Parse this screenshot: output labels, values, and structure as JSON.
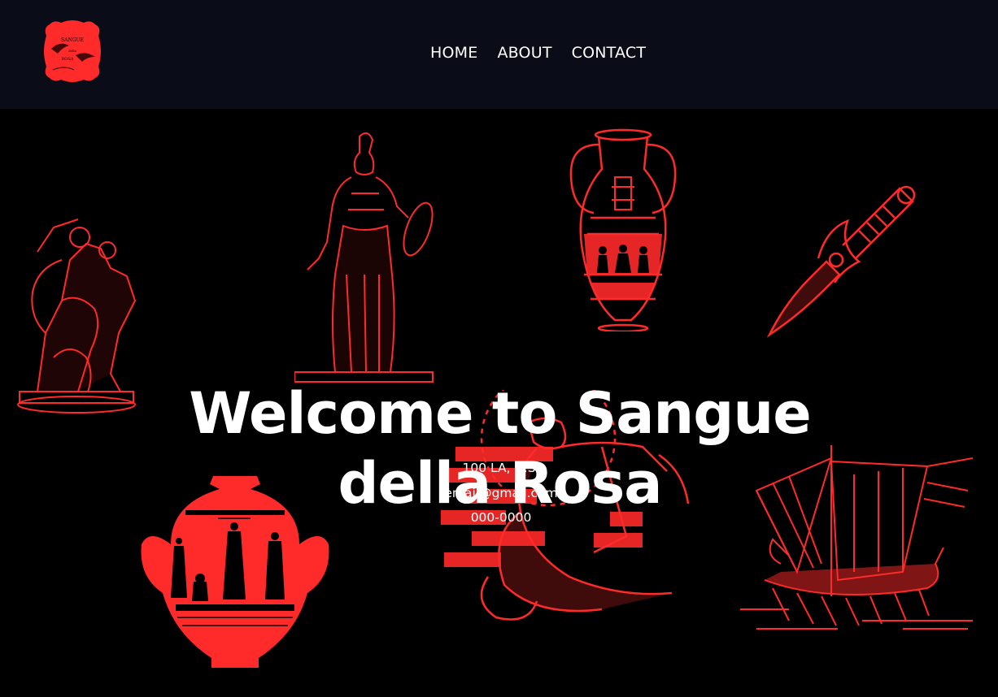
{
  "brand": {
    "logo_icon": "sangue-della-rosa-logo-icon",
    "logo_text": [
      "SANGUE",
      "della",
      "ROSA"
    ],
    "accent": "#ff2a2a",
    "nav_bg": "#0a0d17"
  },
  "nav": {
    "items": [
      {
        "label": "HOME"
      },
      {
        "label": "ABOUT"
      },
      {
        "label": "CONTACT"
      }
    ]
  },
  "hero": {
    "title_line1": "Welcome to Sangue",
    "title_line2": "della Rosa",
    "background_art": [
      "wrestling-statue-icon",
      "athena-statue-icon",
      "greek-amphora-icon",
      "dagger-icon",
      "greek-hydria-vase-icon",
      "seated-muse-icon",
      "trireme-ship-icon"
    ]
  },
  "contact": {
    "address": "100 LA, U.S.",
    "email": "email@gmail.com",
    "phone": "000-0000"
  }
}
